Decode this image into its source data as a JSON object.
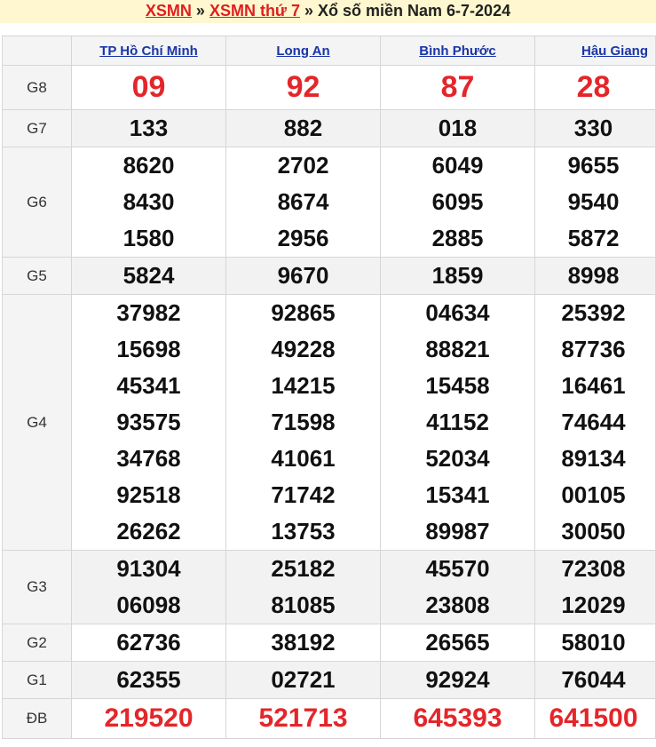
{
  "header": {
    "crumb1": "XSMN",
    "sep1": " » ",
    "crumb2": "XSMN thứ 7",
    "sep2": " » ",
    "title": "Xổ số miền Nam 6-7-2024"
  },
  "provinces": [
    "TP Hồ Chí Minh",
    "Long An",
    "Bình Phước",
    "Hậu Giang"
  ],
  "prizes": {
    "g8": {
      "label": "G8",
      "values": [
        [
          "09"
        ],
        [
          "92"
        ],
        [
          "87"
        ],
        [
          "28"
        ]
      ]
    },
    "g7": {
      "label": "G7",
      "values": [
        [
          "133"
        ],
        [
          "882"
        ],
        [
          "018"
        ],
        [
          "330"
        ]
      ]
    },
    "g6": {
      "label": "G6",
      "values": [
        [
          "8620",
          "8430",
          "1580"
        ],
        [
          "2702",
          "8674",
          "2956"
        ],
        [
          "6049",
          "6095",
          "2885"
        ],
        [
          "9655",
          "9540",
          "5872"
        ]
      ]
    },
    "g5": {
      "label": "G5",
      "values": [
        [
          "5824"
        ],
        [
          "9670"
        ],
        [
          "1859"
        ],
        [
          "8998"
        ]
      ]
    },
    "g4": {
      "label": "G4",
      "values": [
        [
          "37982",
          "15698",
          "45341",
          "93575",
          "34768",
          "92518",
          "26262"
        ],
        [
          "92865",
          "49228",
          "14215",
          "71598",
          "41061",
          "71742",
          "13753"
        ],
        [
          "04634",
          "88821",
          "15458",
          "41152",
          "52034",
          "15341",
          "89987"
        ],
        [
          "25392",
          "87736",
          "16461",
          "74644",
          "89134",
          "00105",
          "30050"
        ]
      ]
    },
    "g3": {
      "label": "G3",
      "values": [
        [
          "91304",
          "06098"
        ],
        [
          "25182",
          "81085"
        ],
        [
          "45570",
          "23808"
        ],
        [
          "72308",
          "12029"
        ]
      ]
    },
    "g2": {
      "label": "G2",
      "values": [
        [
          "62736"
        ],
        [
          "38192"
        ],
        [
          "26565"
        ],
        [
          "58010"
        ]
      ]
    },
    "g1": {
      "label": "G1",
      "values": [
        [
          "62355"
        ],
        [
          "02721"
        ],
        [
          "92924"
        ],
        [
          "76044"
        ]
      ]
    },
    "db": {
      "label": "ĐB",
      "values": [
        [
          "219520"
        ],
        [
          "521713"
        ],
        [
          "645393"
        ],
        [
          "641500"
        ]
      ]
    }
  },
  "colors": {
    "accent_red": "#e4262a",
    "link_blue": "#1a35a8",
    "header_bg": "#fff7cf",
    "row_alt_bg": "#f2f2f2"
  }
}
